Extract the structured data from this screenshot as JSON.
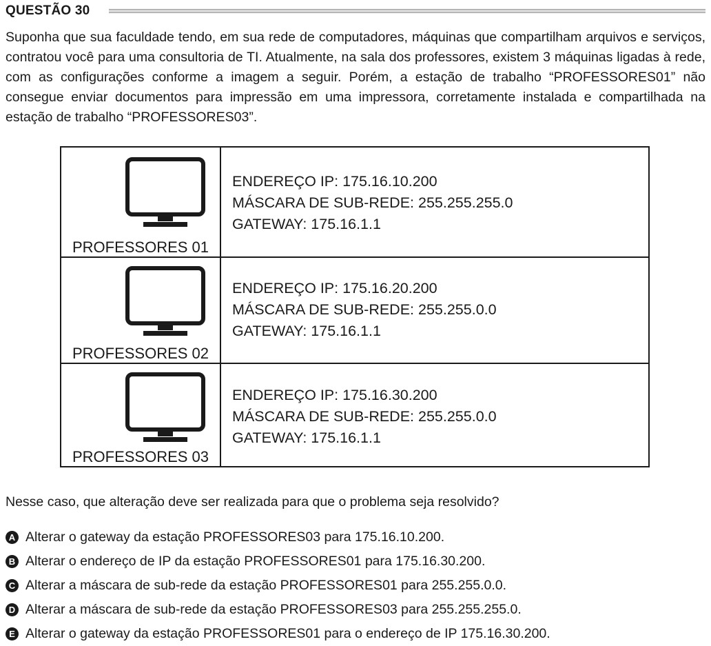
{
  "header": {
    "title": "QUESTÃO 30"
  },
  "intro": "Suponha que sua faculdade tendo, em sua rede de computadores, máquinas que compartilham arquivos e serviços, contratou você para uma consultoria de TI. Atualmente, na sala dos professores, existem 3 máquinas ligadas à rede, com as configurações conforme a imagem a seguir. Porém, a estação de trabalho “PROFESSORES01” não consegue enviar documentos para impressão em uma impressora, corretamente instalada e compartilhada na estação de trabalho “PROFESSORES03”.",
  "table": {
    "rows": [
      {
        "name": "PROFESSORES 01",
        "icon": "monitor-icon",
        "ip": "ENDEREÇO IP: 175.16.10.200",
        "mask": "MÁSCARA DE SUB-REDE: 255.255.255.0",
        "gateway": "GATEWAY: 175.16.1.1"
      },
      {
        "name": "PROFESSORES 02",
        "icon": "monitor-icon",
        "ip": "ENDEREÇO IP: 175.16.20.200",
        "mask": "MÁSCARA DE SUB-REDE: 255.255.0.0",
        "gateway": "GATEWAY: 175.16.1.1"
      },
      {
        "name": "PROFESSORES 03",
        "icon": "monitor-icon",
        "ip": "ENDEREÇO IP: 175.16.30.200",
        "mask": "MÁSCARA DE SUB-REDE: 255.255.0.0",
        "gateway": "GATEWAY: 175.16.1.1"
      }
    ]
  },
  "question": "Nesse caso, que alteração deve ser realizada para que o problema seja resolvido?",
  "options": [
    {
      "letter": "A",
      "text": "Alterar o gateway da estação PROFESSORES03 para 175.16.10.200."
    },
    {
      "letter": "B",
      "text": "Alterar o endereço de IP da estação PROFESSORES01 para 175.16.30.200."
    },
    {
      "letter": "C",
      "text": "Alterar a máscara de sub-rede da estação PROFESSORES01 para 255.255.0.0."
    },
    {
      "letter": "D",
      "text": "Alterar a máscara de sub-rede da estação PROFESSORES03 para 255.255.255.0."
    },
    {
      "letter": "E",
      "text": "Alterar o gateway da estação PROFESSORES01 para o endereço de IP 175.16.30.200."
    }
  ]
}
